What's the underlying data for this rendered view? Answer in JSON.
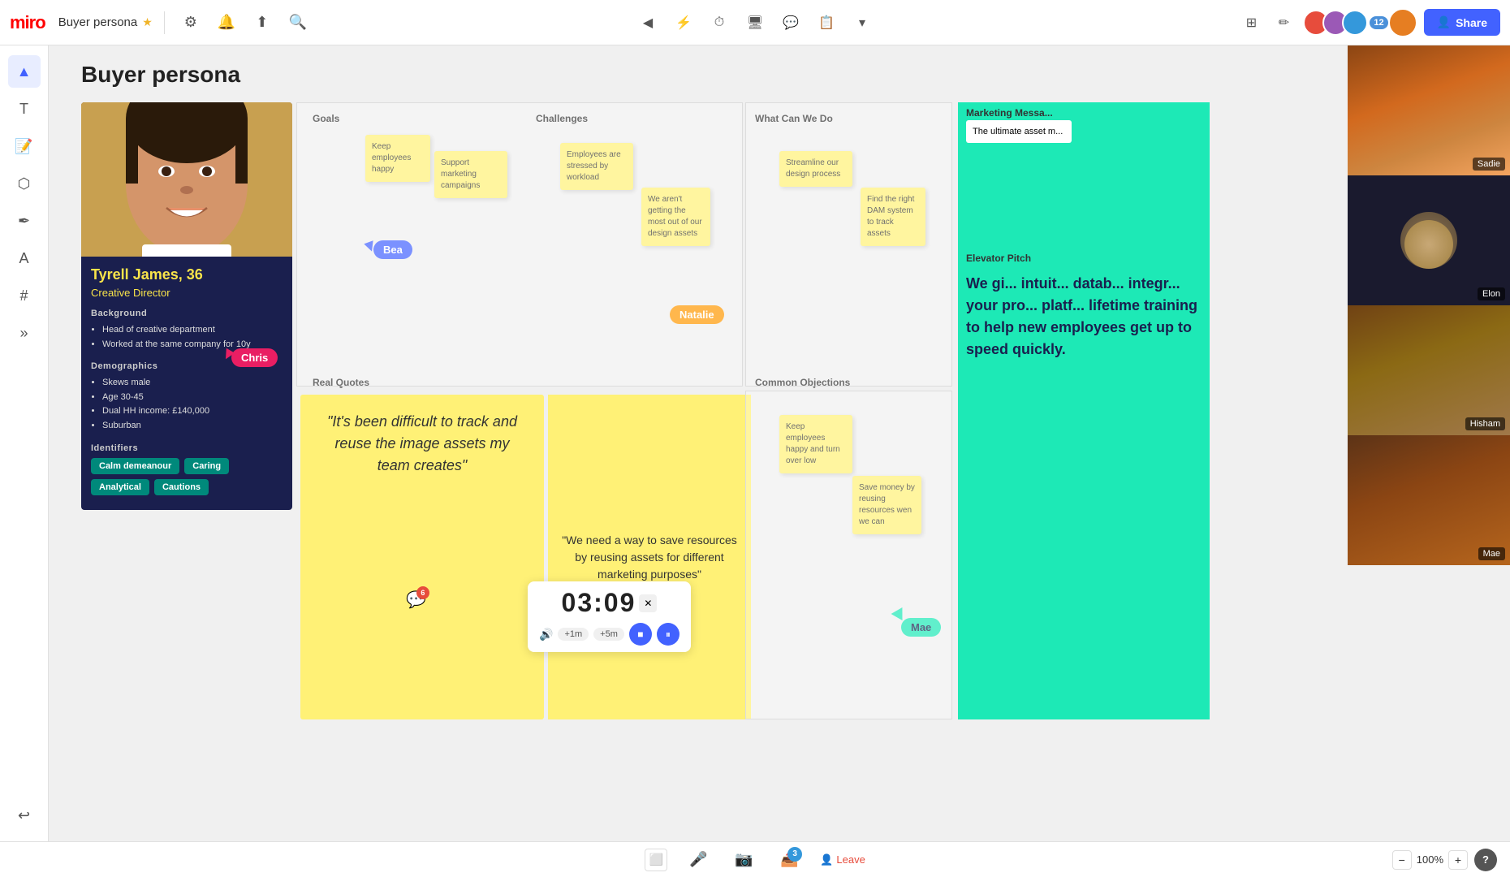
{
  "topbar": {
    "logo": "miro",
    "title": "Buyer persona",
    "star": "★",
    "share_label": "Share",
    "zoom_level": "100%"
  },
  "page": {
    "title": "Buyer persona"
  },
  "persona": {
    "name": "Tyrell James, 36",
    "role": "Creative Director",
    "background_title": "Background",
    "background_items": [
      "Head of creative department",
      "Worked at the same company for 10y"
    ],
    "demographics_title": "Demographics",
    "demographics_items": [
      "Skews male",
      "Age 30-45",
      "Dual HH income: £140,000",
      "Suburban"
    ],
    "identifiers_title": "Identifiers",
    "tags": [
      "Calm demeanour",
      "Caring",
      "Analytical",
      "Cautions"
    ]
  },
  "sections": {
    "goals": "Goals",
    "challenges": "Challenges",
    "what_can_we_do": "What Can We Do",
    "real_quotes": "Real Quotes",
    "common_objections": "Common Objections",
    "marketing_messages": "Marketing Messa...",
    "elevator_pitch": "Elevator Pitch"
  },
  "sticky_notes": {
    "goals_1": "Keep employees happy",
    "goals_2": "Support marketing campaigns",
    "challenges_1": "Employees are stressed by workload",
    "challenges_2": "We aren't getting the most out of our design assets",
    "what_we_do_1": "Streamline our design process",
    "what_we_do_2": "Find the right DAM system to track assets",
    "objections_1": "Keep employees happy and turn over low",
    "objections_2": "Save money by reusing resources wen we can"
  },
  "quotes": {
    "real_quote": "\"It's been difficult to track and reuse the image assets my team creates\"",
    "second_quote": "\"We need a way to save resources by reusing assets for different marketing purposes\""
  },
  "elevator_pitch": {
    "text": "We gi... intuit... datab... integr... your pro... platf... lifetime training to help new employees get up to speed quickly."
  },
  "timer": {
    "display": "03:09",
    "stop_label": "■",
    "pause_label": "⏸",
    "plus1_label": "+1m",
    "plus5_label": "+5m"
  },
  "cursors": {
    "bea": "Bea",
    "chris": "Chris",
    "natalie": "Natalie",
    "mae": "Mae"
  },
  "chat": {
    "badge_count": "6"
  },
  "video": {
    "persons": [
      "Sadie",
      "Elon",
      "Hisham",
      "Mae"
    ]
  },
  "bottom": {
    "zoom_level": "100%",
    "leave_label": "Leave"
  }
}
